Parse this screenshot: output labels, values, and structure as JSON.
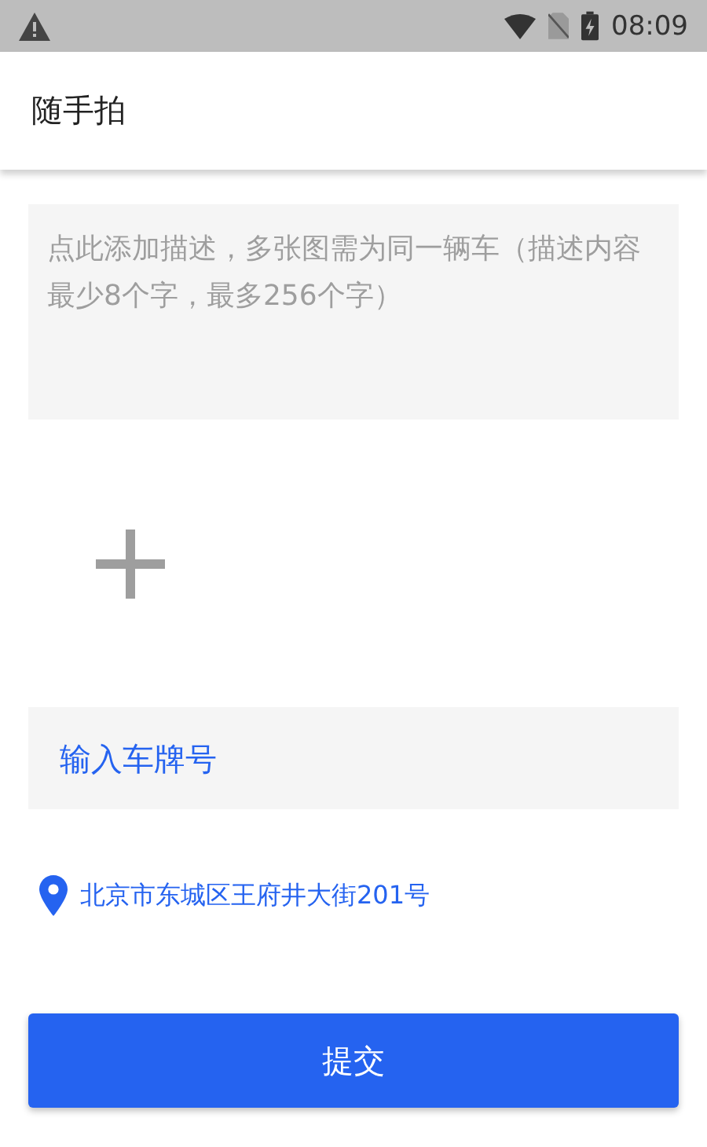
{
  "status_bar": {
    "time": "08:09"
  },
  "app_bar": {
    "title": "随手拍"
  },
  "description": {
    "placeholder": "点此添加描述，多张图需为同一辆车（描述内容最少8个字，最多256个字）"
  },
  "plate": {
    "placeholder": "输入车牌号"
  },
  "location": {
    "address": "北京市东城区王府井大街201号"
  },
  "submit": {
    "label": "提交"
  }
}
